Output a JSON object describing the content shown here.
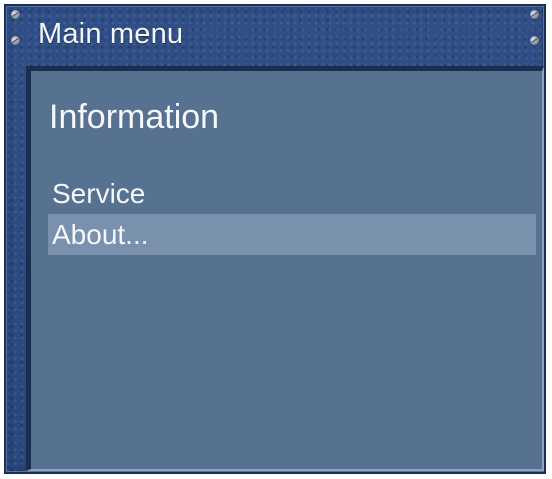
{
  "window": {
    "title": "Main menu"
  },
  "content": {
    "heading": "Information",
    "menu_items": [
      {
        "label": "Service",
        "selected": false
      },
      {
        "label": "About...",
        "selected": true
      }
    ]
  },
  "colors": {
    "frame": "#2f4d84",
    "panel": "#577191",
    "selected_row": "#7a91ae",
    "text": "#f5f7fb"
  }
}
